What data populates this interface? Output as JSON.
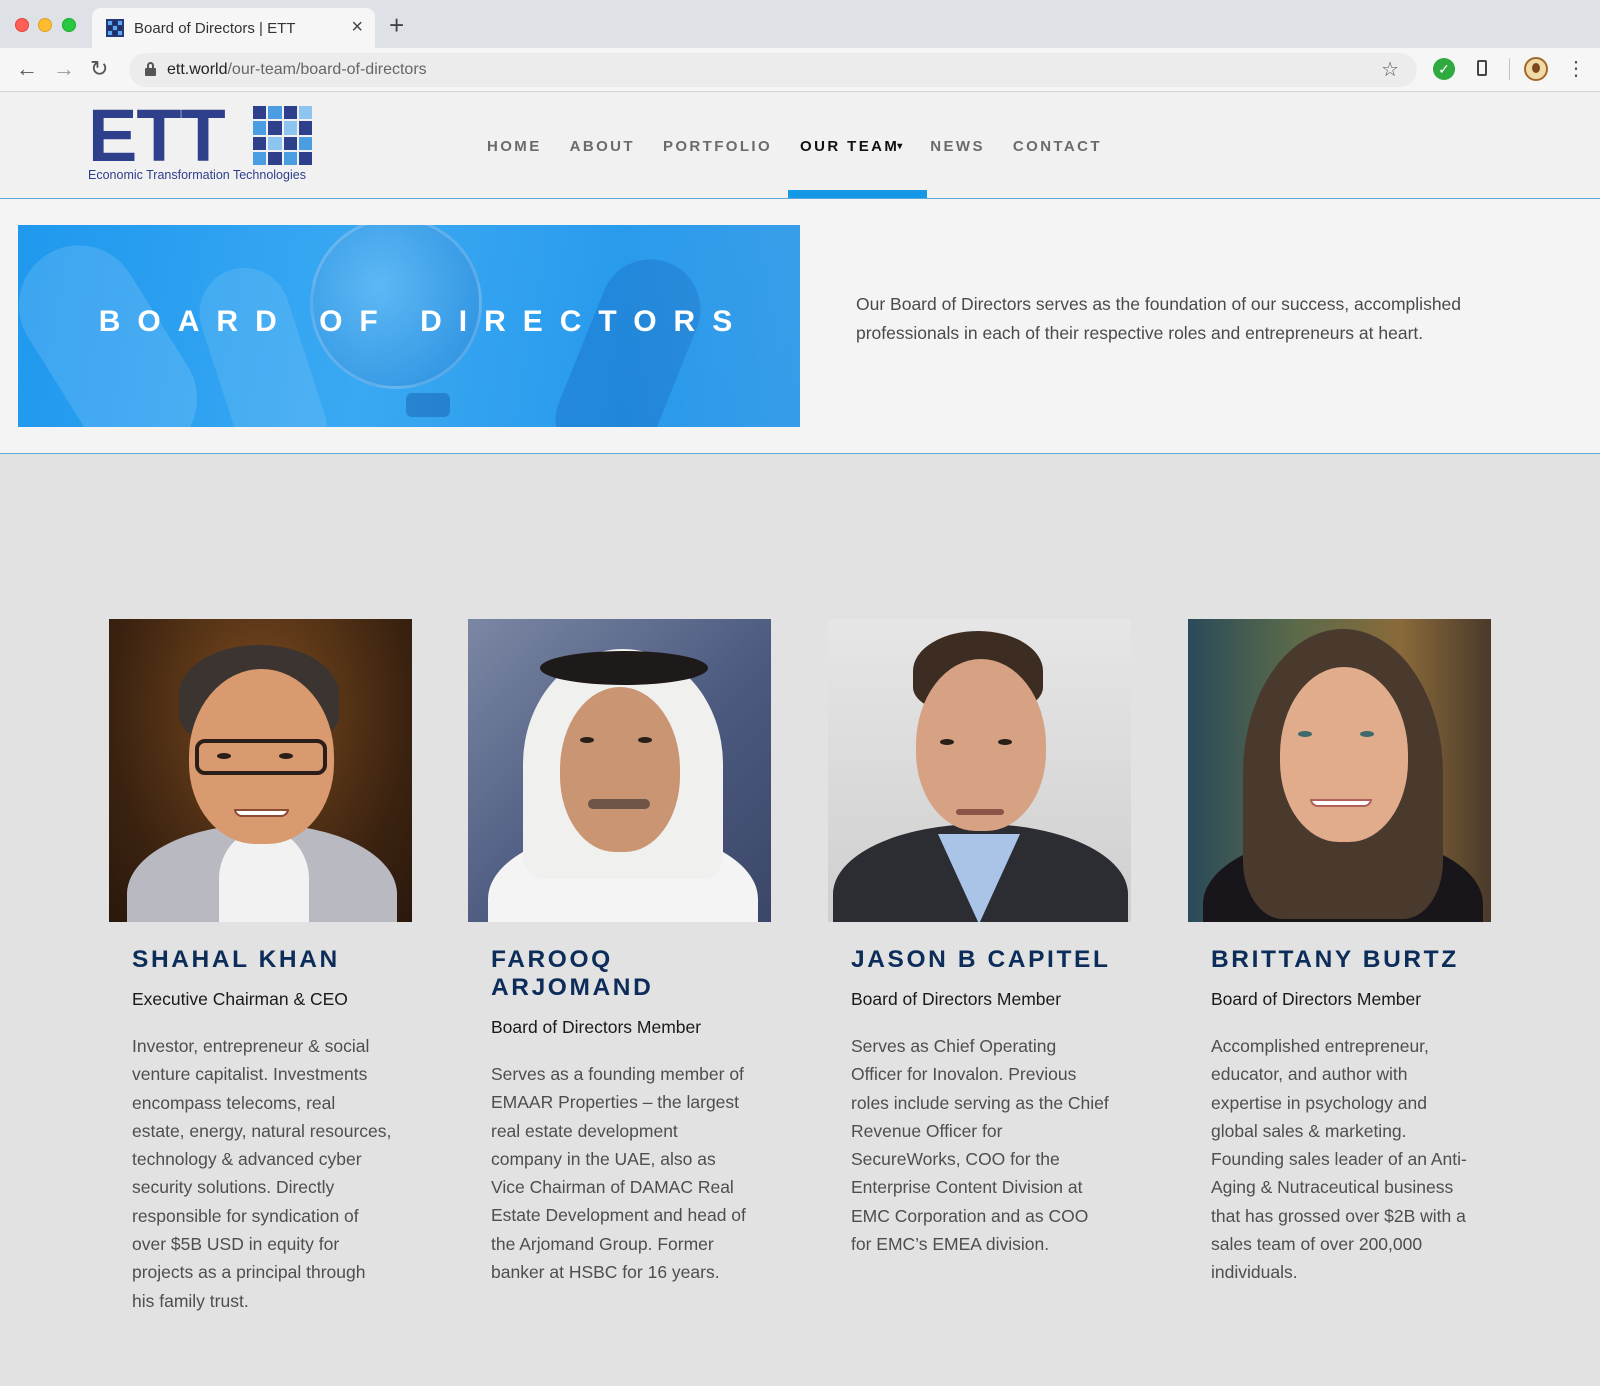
{
  "browser": {
    "tab_title": "Board of Directors | ETT",
    "url_domain": "ett.world",
    "url_path": "/our-team/board-of-directors"
  },
  "site": {
    "logo_text": "ETT",
    "logo_tagline": "Economic Transformation Technologies",
    "nav": [
      {
        "label": "HOME"
      },
      {
        "label": "ABOUT"
      },
      {
        "label": "PORTFOLIO"
      },
      {
        "label": "OUR TEAM",
        "active": true
      },
      {
        "label": "NEWS"
      },
      {
        "label": "CONTACT"
      }
    ],
    "brand_color": "#2e3f8c",
    "accent_color": "#1598e6"
  },
  "hero": {
    "title": "BOARD OF DIRECTORS",
    "description": "Our Board of Directors serves as the foundation of our success, accomplished professionals in each of their respective roles and entrepreneurs at heart."
  },
  "members": [
    {
      "name": "SHAHAL KHAN",
      "role": "Executive Chairman & CEO",
      "bio": "Investor, entrepreneur & social venture capitalist. Investments encompass telecoms, real estate, energy, natural resources, technology & advanced cyber security solutions. Directly responsible for syndication of over $5B USD in equity for projects as a principal through his family trust."
    },
    {
      "name": "FAROOQ ARJOMAND",
      "role": "Board of Directors Member",
      "bio": "Serves as a founding member of EMAAR Properties – the largest real estate development company in the UAE, also as Vice Chairman of DAMAC Real Estate Development and head of the Arjomand Group. Former banker at HSBC for 16 years."
    },
    {
      "name": "JASON B CAPITEL",
      "role": "Board of Directors Member",
      "bio": "Serves as Chief Operating Officer for Inovalon. Previous roles include serving as the Chief Revenue Officer for SecureWorks, COO for the Enterprise Content Division at EMC Corporation and as COO for EMC’s EMEA division."
    },
    {
      "name": "BRITTANY BURTZ",
      "role": "Board of Directors Member",
      "bio": "Accomplished entrepreneur, educator, and author with expertise in psychology and global sales & marketing. Founding sales leader of an Anti-Aging & Nutraceutical business that has grossed over $2B with a sales team of over 200,000 individuals."
    }
  ]
}
